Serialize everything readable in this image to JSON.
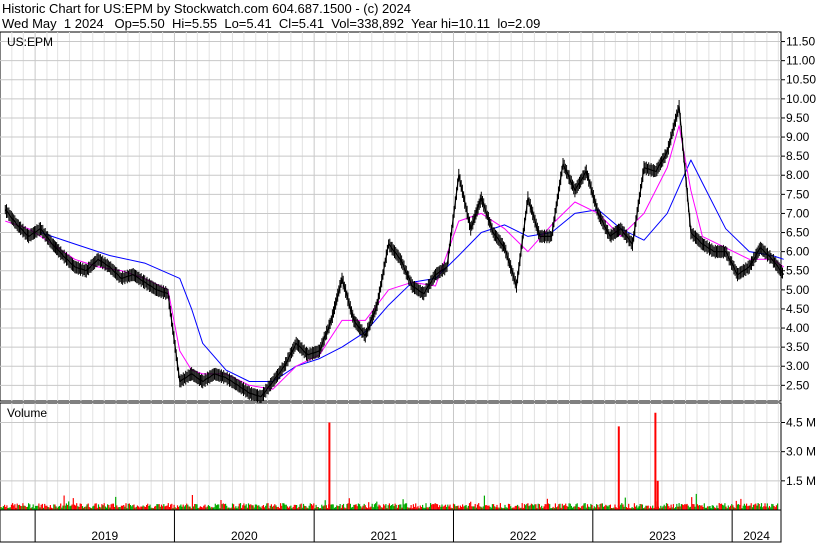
{
  "header": {
    "line1": "Historic Chart for US:EPM by Stockwatch.com 604.687.1500 - (c) 2024",
    "line2": "Wed May  1 2024   Op=5.50  Hi=5.55  Lo=5.41  Cl=5.41  Vol=338,892  Year hi=10.11  lo=2.09"
  },
  "colors": {
    "price": "#000000",
    "ma_short": "#ff00ff",
    "ma_long": "#0000ff",
    "volume_up": "#00aa00",
    "volume_down": "#ff0000",
    "grid": "#c8c8c8"
  },
  "chart_data": [
    {
      "type": "line",
      "panel": "price",
      "label": "US:EPM",
      "yticks": [
        "11.50",
        "11.00",
        "10.50",
        "10.00",
        "9.50",
        "9.00",
        "8.50",
        "8.00",
        "7.50",
        "7.00",
        "6.50",
        "6.00",
        "5.50",
        "5.00",
        "4.50",
        "4.00",
        "3.50",
        "3.00",
        "2.50"
      ],
      "ylim": [
        2.09,
        11.75
      ],
      "x_labels": [
        "2019",
        "2020",
        "2021",
        "2022",
        "2023",
        "2024"
      ],
      "x_range": [
        "2018-10",
        "2024-05"
      ],
      "series": [
        {
          "role": "close",
          "x": [
            "2018-10",
            "2018-11",
            "2018-12",
            "2019-01",
            "2019-02",
            "2019-03",
            "2019-04",
            "2019-05",
            "2019-06",
            "2019-07",
            "2019-08",
            "2019-09",
            "2019-10",
            "2019-11",
            "2019-12",
            "2020-01",
            "2020-02",
            "2020-03",
            "2020-04",
            "2020-05",
            "2020-06",
            "2020-07",
            "2020-08",
            "2020-09",
            "2020-10",
            "2020-11",
            "2020-12",
            "2021-01",
            "2021-02",
            "2021-03",
            "2021-04",
            "2021-05",
            "2021-06",
            "2021-07",
            "2021-08",
            "2021-09",
            "2021-10",
            "2021-11",
            "2021-12",
            "2022-01",
            "2022-02",
            "2022-03",
            "2022-04",
            "2022-05",
            "2022-06",
            "2022-07",
            "2022-08",
            "2022-09",
            "2022-10",
            "2022-11",
            "2022-12",
            "2023-01",
            "2023-02",
            "2023-03",
            "2023-04",
            "2023-05",
            "2023-06",
            "2023-07",
            "2023-08",
            "2023-09",
            "2023-10",
            "2023-11",
            "2023-12",
            "2024-01",
            "2024-02",
            "2024-03",
            "2024-04",
            "2024-05"
          ],
          "values": [
            7.1,
            6.7,
            6.4,
            6.6,
            6.2,
            5.9,
            5.6,
            5.5,
            5.8,
            5.6,
            5.3,
            5.4,
            5.2,
            5.0,
            4.9,
            2.6,
            2.8,
            2.6,
            2.8,
            2.7,
            2.5,
            2.3,
            2.2,
            2.6,
            3.0,
            3.6,
            3.3,
            3.4,
            4.2,
            5.3,
            4.2,
            3.8,
            4.6,
            6.2,
            5.8,
            5.1,
            4.9,
            5.4,
            5.6,
            8.0,
            6.6,
            7.4,
            6.5,
            6.1,
            5.1,
            7.4,
            6.4,
            6.4,
            8.3,
            7.6,
            8.1,
            7.0,
            6.4,
            6.6,
            6.2,
            8.2,
            8.1,
            8.6,
            9.8,
            6.5,
            6.2,
            6.0,
            6.0,
            5.4,
            5.6,
            6.1,
            5.8,
            5.4
          ]
        },
        {
          "role": "moving-average-short",
          "x": [
            "2018-10",
            "2018-12",
            "2019-02",
            "2019-04",
            "2019-06",
            "2019-08",
            "2019-10",
            "2019-12",
            "2020-01",
            "2020-02",
            "2020-03",
            "2020-05",
            "2020-07",
            "2020-09",
            "2020-11",
            "2021-01",
            "2021-03",
            "2021-05",
            "2021-07",
            "2021-09",
            "2021-11",
            "2022-01",
            "2022-03",
            "2022-05",
            "2022-07",
            "2022-09",
            "2022-11",
            "2023-01",
            "2023-03",
            "2023-05",
            "2023-07",
            "2023-08",
            "2023-09",
            "2023-10",
            "2023-12",
            "2024-02",
            "2024-04",
            "2024-05"
          ],
          "values": [
            6.8,
            6.6,
            6.2,
            5.8,
            5.6,
            5.5,
            5.3,
            5.0,
            3.4,
            2.9,
            2.8,
            2.8,
            2.5,
            2.4,
            3.0,
            3.3,
            4.2,
            4.2,
            5.0,
            5.2,
            5.1,
            6.8,
            7.0,
            6.6,
            6.0,
            6.7,
            7.3,
            7.0,
            6.4,
            7.0,
            8.2,
            9.3,
            7.6,
            6.4,
            6.1,
            5.8,
            5.8,
            5.6
          ]
        },
        {
          "role": "moving-average-long",
          "x": [
            "2019-01",
            "2019-04",
            "2019-07",
            "2019-10",
            "2020-01",
            "2020-02",
            "2020-03",
            "2020-05",
            "2020-07",
            "2020-09",
            "2020-11",
            "2021-01",
            "2021-03",
            "2021-05",
            "2021-07",
            "2021-09",
            "2021-11",
            "2022-01",
            "2022-03",
            "2022-05",
            "2022-07",
            "2022-09",
            "2022-11",
            "2023-01",
            "2023-03",
            "2023-05",
            "2023-07",
            "2023-09",
            "2023-10",
            "2023-12",
            "2024-02",
            "2024-04",
            "2024-05"
          ],
          "values": [
            6.5,
            6.2,
            5.9,
            5.7,
            5.3,
            4.5,
            3.6,
            2.9,
            2.6,
            2.6,
            3.0,
            3.2,
            3.5,
            3.9,
            4.6,
            5.2,
            5.3,
            5.9,
            6.5,
            6.7,
            6.4,
            6.5,
            7.0,
            7.1,
            6.6,
            6.3,
            7.0,
            8.4,
            7.8,
            6.6,
            6.0,
            5.9,
            5.8
          ]
        }
      ]
    },
    {
      "type": "bar",
      "panel": "volume",
      "label": "Volume",
      "yticks": [
        "4.5 M",
        "3.0 M",
        "1.5 M"
      ],
      "ylim": [
        0,
        5.4
      ],
      "unit": "M",
      "spikes": [
        {
          "date": "2021-02-10",
          "value": 4.5
        },
        {
          "date": "2023-03-10",
          "value": 4.3
        },
        {
          "date": "2023-06-14",
          "value": 5.0
        },
        {
          "date": "2023-06-20",
          "value": 1.5
        }
      ],
      "typical_volume": 0.3
    }
  ]
}
